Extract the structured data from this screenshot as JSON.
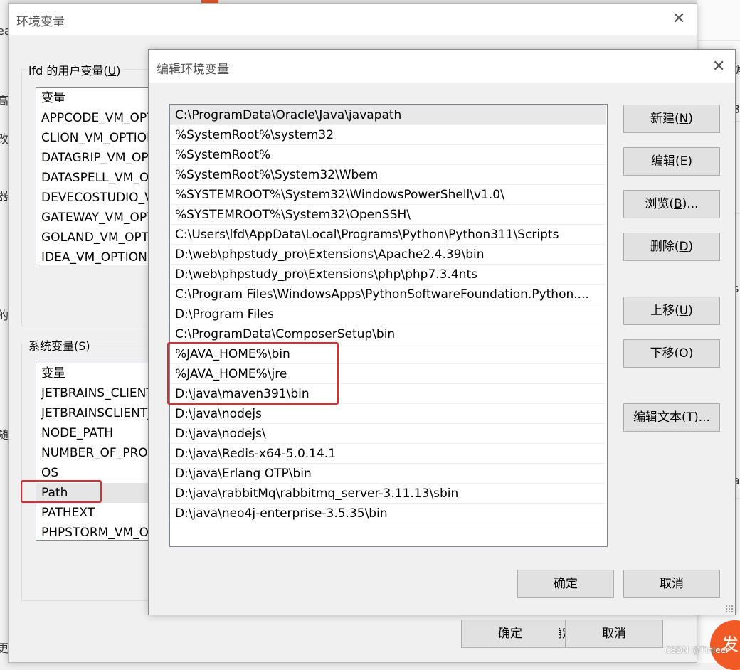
{
  "background": {
    "left_chars": [
      "ea",
      "高",
      "改",
      "器",
      "的",
      "随",
      "更"
    ],
    "right_chars": [
      "编",
      "3",
      "s",
      "a"
    ],
    "fab_label": "发",
    "watermark": "CSDN @Tinleer"
  },
  "parent_dialog": {
    "title": "环境变量",
    "user_vars_label": "lfd 的用户变量(",
    "user_vars_label_key": "U",
    "user_vars_label_end": ")",
    "user_vars_header": "变量",
    "user_vars": [
      "APPCODE_VM_OPTIONS",
      "CLION_VM_OPTIONS",
      "DATAGRIP_VM_OPTIONS",
      "DATASPELL_VM_OPTIONS",
      "DEVECOSTUDIO_VM_OPTIONS",
      "GATEWAY_VM_OPTIONS",
      "GOLAND_VM_OPTIONS",
      "IDEA_VM_OPTIONS"
    ],
    "sys_vars_label": "系统变量(",
    "sys_vars_label_key": "S",
    "sys_vars_label_end": ")",
    "sys_vars_header": "变量",
    "sys_vars": [
      "JETBRAINS_CLIENT_VM_OPTIONS",
      "JETBRAINSCLIENT_VM_OPTIONS",
      "NODE_PATH",
      "NUMBER_OF_PROCESSORS",
      "OS",
      "Path",
      "PATHEXT",
      "PHPSTORM_VM_OPTIONS"
    ],
    "selected_sys_var": "Path",
    "ok_label": "确定",
    "cancel_label": "取消"
  },
  "edit_dialog": {
    "title": "编辑环境变量",
    "paths": [
      "C:\\ProgramData\\Oracle\\Java\\javapath",
      "%SystemRoot%\\system32",
      "%SystemRoot%",
      "%SystemRoot%\\System32\\Wbem",
      "%SYSTEMROOT%\\System32\\WindowsPowerShell\\v1.0\\",
      "%SYSTEMROOT%\\System32\\OpenSSH\\",
      "C:\\Users\\lfd\\AppData\\Local\\Programs\\Python\\Python311\\Scripts",
      "D:\\web\\phpstudy_pro\\Extensions\\Apache2.4.39\\bin",
      "D:\\web\\phpstudy_pro\\Extensions\\php\\php7.3.4nts",
      "C:\\Program Files\\WindowsApps\\PythonSoftwareFoundation.Python....",
      "D:\\Program Files",
      "C:\\ProgramData\\ComposerSetup\\bin",
      "%JAVA_HOME%\\bin",
      "%JAVA_HOME%\\jre",
      "D:\\java\\maven391\\bin",
      "D:\\java\\nodejs",
      "D:\\java\\nodejs\\",
      "D:\\java\\Redis-x64-5.0.14.1",
      "D:\\java\\Erlang OTP\\bin",
      "D:\\java\\rabbitMq\\rabbitmq_server-3.11.13\\sbin",
      "D:\\java\\neo4j-enterprise-3.5.35\\bin"
    ],
    "selected_index": 0,
    "buttons": {
      "new": {
        "label": "新建(",
        "key": "N",
        "end": ")"
      },
      "edit": {
        "label": "编辑(",
        "key": "E",
        "end": ")"
      },
      "browse": {
        "label": "浏览(",
        "key": "B",
        "end": ")..."
      },
      "delete": {
        "label": "删除(",
        "key": "D",
        "end": ")"
      },
      "move_up": {
        "label": "上移(",
        "key": "U",
        "end": ")"
      },
      "move_down": {
        "label": "下移(",
        "key": "O",
        "end": ")"
      },
      "edit_text": {
        "label": "编辑文本(",
        "key": "T",
        "end": ")..."
      }
    },
    "ok_label": "确定",
    "cancel_label": "取消"
  },
  "annotation_color": "#e8262d"
}
